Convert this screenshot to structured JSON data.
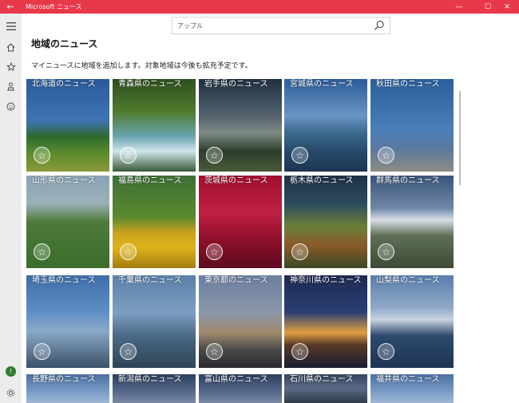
{
  "window": {
    "back_icon": "back-arrow-icon",
    "title": "Microsoft ニュース",
    "minimize_glyph": "—",
    "maximize_glyph": "☐",
    "close_glyph": "✕"
  },
  "rail": {
    "items": [
      "menu-icon",
      "home-icon",
      "favorites-icon",
      "local-icon",
      "emoji-icon"
    ],
    "avatar_glyph": "!",
    "settings_icon": "gear-icon"
  },
  "search": {
    "value": "",
    "placeholder": "アップル",
    "icon": "search-icon"
  },
  "page": {
    "title": "地域のニュース",
    "subtitle": "マイニュースに地域を追加します。対象地域は今後も拡充予定です。"
  },
  "regions": [
    {
      "label": "北海道のニュース",
      "theme": "field"
    },
    {
      "label": "青森県のニュース",
      "theme": "river"
    },
    {
      "label": "岩手県のニュース",
      "theme": "bridge"
    },
    {
      "label": "宮城県のニュース",
      "theme": "coast"
    },
    {
      "label": "秋田県のニュース",
      "theme": "statue"
    },
    {
      "label": "山形県のニュース",
      "theme": "paddy"
    },
    {
      "label": "福島県のニュース",
      "theme": "sunflower"
    },
    {
      "label": "茨城県のニュース",
      "theme": "flowers"
    },
    {
      "label": "栃木県のニュース",
      "theme": "waterfall"
    },
    {
      "label": "群馬県のニュース",
      "theme": "mountain"
    },
    {
      "label": "埼玉県のニュース",
      "theme": "towers"
    },
    {
      "label": "千葉県のニュース",
      "theme": "glass"
    },
    {
      "label": "東京都のニュース",
      "theme": "skyline"
    },
    {
      "label": "神奈川県のニュース",
      "theme": "night"
    },
    {
      "label": "山梨県のニュース",
      "theme": "fuji"
    },
    {
      "label": "長野県のニュース",
      "theme": "sky"
    },
    {
      "label": "新潟県のニュース",
      "theme": "dusk"
    },
    {
      "label": "富山県のニュース",
      "theme": "dusk"
    },
    {
      "label": "石川県のニュース",
      "theme": "bridge2"
    },
    {
      "label": "福井県のニュース",
      "theme": "sky"
    }
  ],
  "star_glyph": "☆"
}
